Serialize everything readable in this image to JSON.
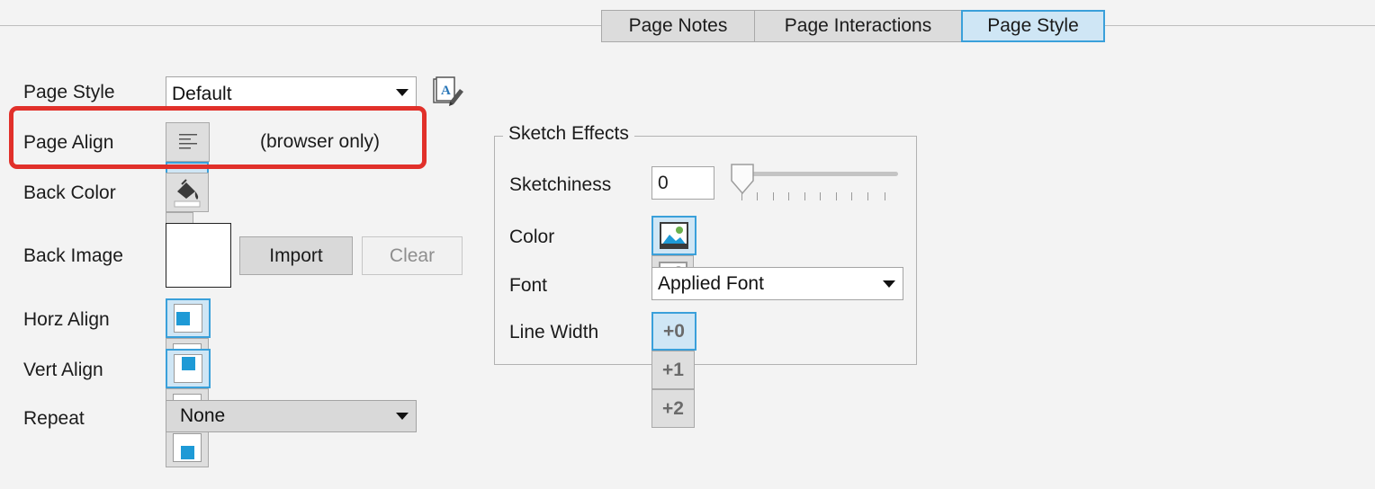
{
  "tabs": [
    {
      "label": "Page Notes",
      "active": false
    },
    {
      "label": "Page Interactions",
      "active": false
    },
    {
      "label": "Page Style",
      "active": true
    }
  ],
  "page_style": {
    "label": "Page Style",
    "value": "Default",
    "icon": "page-style-edit-icon"
  },
  "page_align": {
    "label": "Page Align",
    "hint": "(browser only)",
    "options": [
      "align-left-icon",
      "align-center-icon"
    ],
    "selected": "center"
  },
  "back_color": {
    "label": "Back Color",
    "icon": "paint-bucket-icon",
    "swatch": "#ffffff"
  },
  "back_image": {
    "label": "Back Image",
    "import_label": "Import",
    "clear_label": "Clear"
  },
  "horz_align": {
    "label": "Horz Align",
    "options": [
      "left",
      "center",
      "right"
    ],
    "selected": "left"
  },
  "vert_align": {
    "label": "Vert Align",
    "options": [
      "top",
      "middle",
      "bottom"
    ],
    "selected": "top"
  },
  "repeat": {
    "label": "Repeat",
    "value": "None"
  },
  "sketch": {
    "title": "Sketch Effects",
    "sketchiness_label": "Sketchiness",
    "sketchiness_value": "0",
    "color_label": "Color",
    "color_options": [
      "color-image-icon",
      "grayscale-image-icon"
    ],
    "color_selected": "color",
    "font_label": "Font",
    "font_value": "Applied Font",
    "line_width_label": "Line Width",
    "line_width_options": [
      "+0",
      "+1",
      "+2"
    ],
    "line_width_selected": "+0"
  },
  "colors": {
    "accent": "#3aa0da",
    "selected_bg": "#cfe6f5",
    "highlight": "#e1302a",
    "align_dot": "#1e9ad6"
  }
}
